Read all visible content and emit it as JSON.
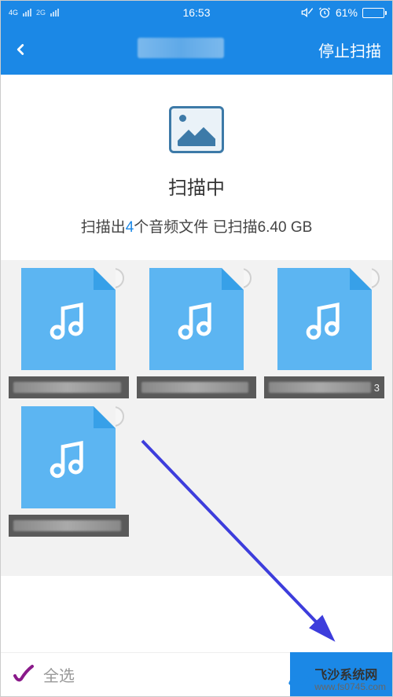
{
  "status": {
    "network1": "4G",
    "network2": "2G",
    "time": "16:53",
    "battery_pct": "61%",
    "icons": [
      "no-sound-icon",
      "alarm-icon"
    ]
  },
  "header": {
    "stop_scan_label": "停止扫描"
  },
  "scan": {
    "title": "扫描中",
    "summary_prefix": "扫描出",
    "count": "4",
    "summary_mid": "个音频文件 已扫描",
    "size": "6.40 GB"
  },
  "files": [
    {
      "name_blurred": true,
      "suffix": ""
    },
    {
      "name_blurred": true,
      "suffix": ""
    },
    {
      "name_blurred": true,
      "suffix": "3"
    },
    {
      "name_blurred": true,
      "suffix": ""
    }
  ],
  "bottom": {
    "select_all_label": "全选"
  },
  "watermark": {
    "name": "飞沙系统网",
    "url": "www.fs0745.com"
  }
}
